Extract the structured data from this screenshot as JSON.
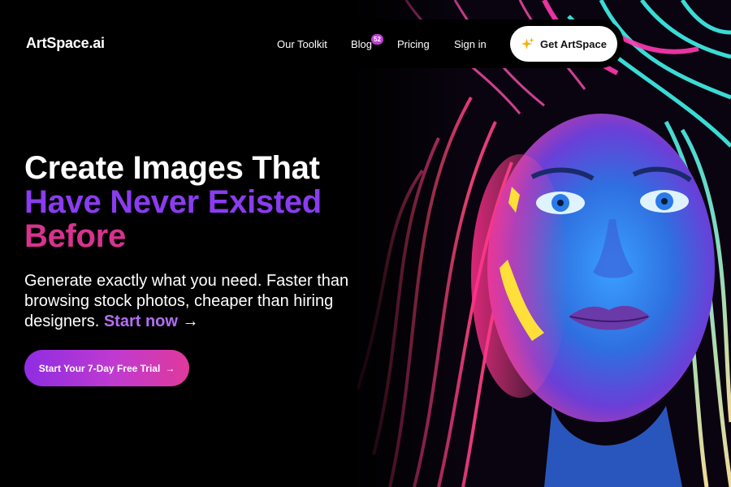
{
  "nav": {
    "logo_main": "ArtSpace",
    "logo_suffix": ".ai",
    "links": [
      {
        "label": "Our Toolkit"
      },
      {
        "label": "Blog",
        "badge": "52"
      },
      {
        "label": "Pricing"
      },
      {
        "label": "Sign in"
      }
    ],
    "cta_label": "Get ArtSpace",
    "cta_icon": "sparkle-icon"
  },
  "hero": {
    "title_line1": "Create Images That",
    "title_line2": "Have Never Existed",
    "title_line3": "Before",
    "subtitle": "Generate exactly what you need. Faster than browsing stock photos, cheaper than hiring designers.",
    "start_link": "Start now",
    "start_arrow": "→",
    "trial_label": "Start Your 7-Day Free Trial",
    "trial_arrow": "→"
  },
  "colors": {
    "accent_purple": "#8a3cf0",
    "accent_pink": "#d8328f",
    "badge": "#c23bd6"
  }
}
